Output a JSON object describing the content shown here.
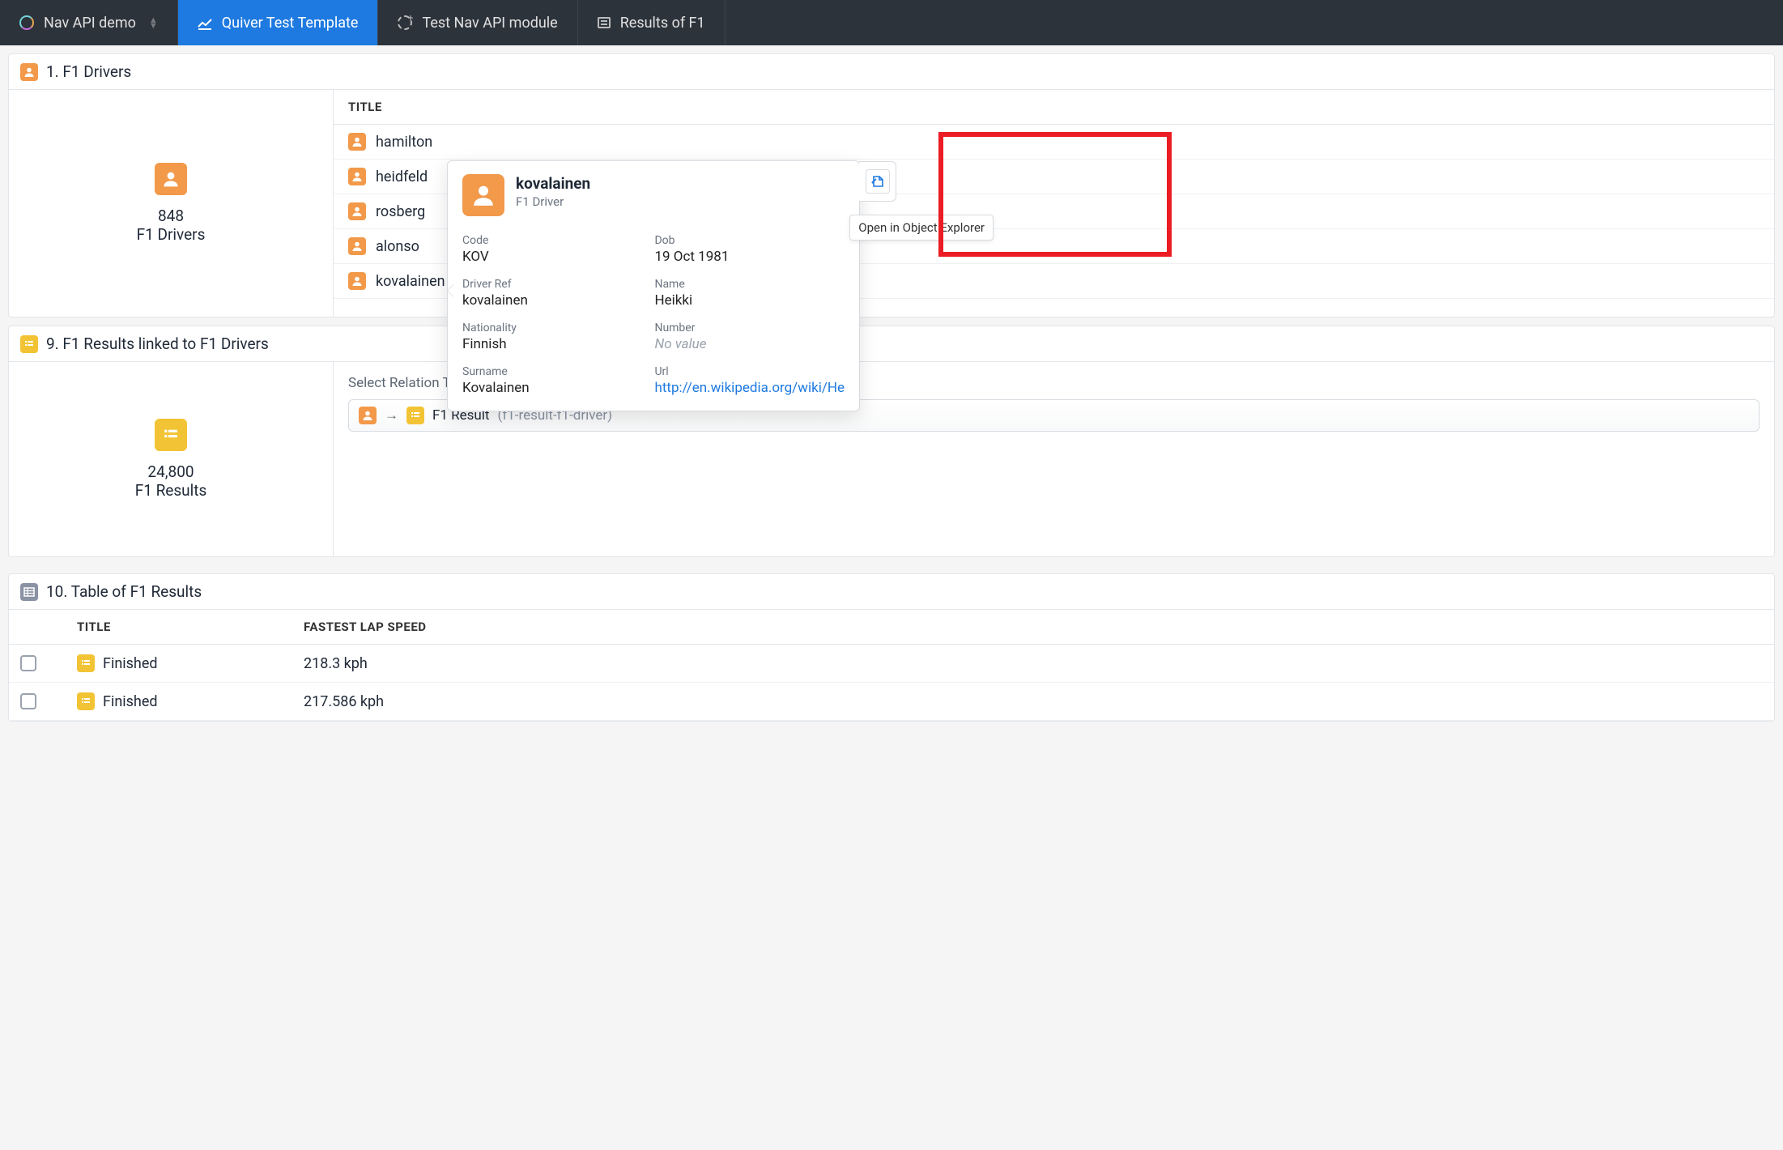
{
  "tabs": {
    "items": [
      {
        "label": "Nav API demo"
      },
      {
        "label": "Quiver Test Template"
      },
      {
        "label": "Test Nav API module"
      },
      {
        "label": "Results of F1"
      }
    ]
  },
  "panel1": {
    "title": "1. F1 Drivers",
    "count": "848",
    "countLabel": "F1 Drivers",
    "columnHeader": "TITLE",
    "rows": [
      "hamilton",
      "heidfeld",
      "rosberg",
      "alonso",
      "kovalainen"
    ]
  },
  "popover": {
    "title": "kovalainen",
    "subtitle": "F1 Driver",
    "fields": [
      {
        "label": "Code",
        "value": "KOV"
      },
      {
        "label": "Dob",
        "value": "19 Oct 1981"
      },
      {
        "label": "Driver Ref",
        "value": "kovalainen"
      },
      {
        "label": "Name",
        "value": "Heikki"
      },
      {
        "label": "Nationality",
        "value": "Finnish"
      },
      {
        "label": "Number",
        "value": "No value",
        "muted": true
      },
      {
        "label": "Surname",
        "value": "Kovalainen"
      },
      {
        "label": "Url",
        "value": "http://en.wikipedia.org/wiki/He",
        "link": true
      }
    ],
    "tooltip": "Open in Object Explorer"
  },
  "panel2": {
    "title": "9. F1 Results linked to F1 Drivers",
    "count": "24,800",
    "countLabel": "F1 Results",
    "selectLabel": "Select Relation Ty",
    "relationMain": "F1 Result",
    "relationSub": "(f1-result-f1-driver)"
  },
  "panel3": {
    "title": "10. Table of F1 Results",
    "columns": [
      "TITLE",
      "FASTEST LAP SPEED"
    ],
    "rows": [
      {
        "title": "Finished",
        "speed": "218.3 kph"
      },
      {
        "title": "Finished",
        "speed": "217.586 kph"
      }
    ]
  }
}
